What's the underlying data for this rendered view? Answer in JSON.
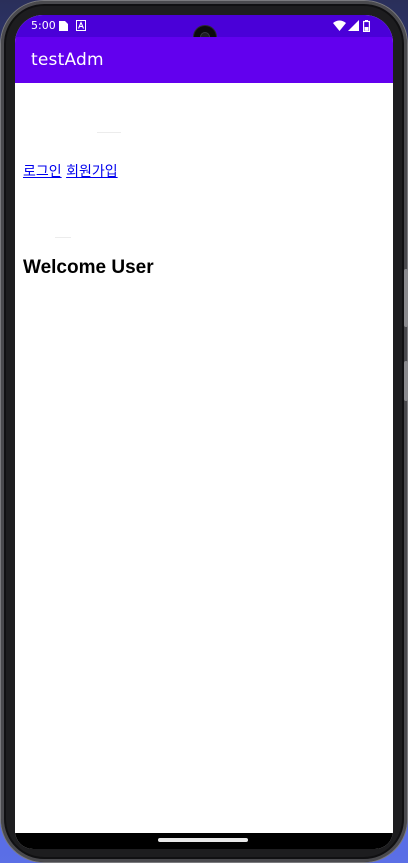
{
  "status_bar": {
    "time": "5:00",
    "icons": [
      "sim-card-icon",
      "accessibility-icon",
      "wifi-icon",
      "signal-icon",
      "battery-icon"
    ]
  },
  "app_bar": {
    "title": "testAdm"
  },
  "links": {
    "login": "로그인",
    "signup": "회원가입"
  },
  "main": {
    "heading": "Welcome User"
  },
  "colors": {
    "status_bar": "#4a00d8",
    "app_bar": "#6200ee",
    "link": "#0000ee"
  }
}
